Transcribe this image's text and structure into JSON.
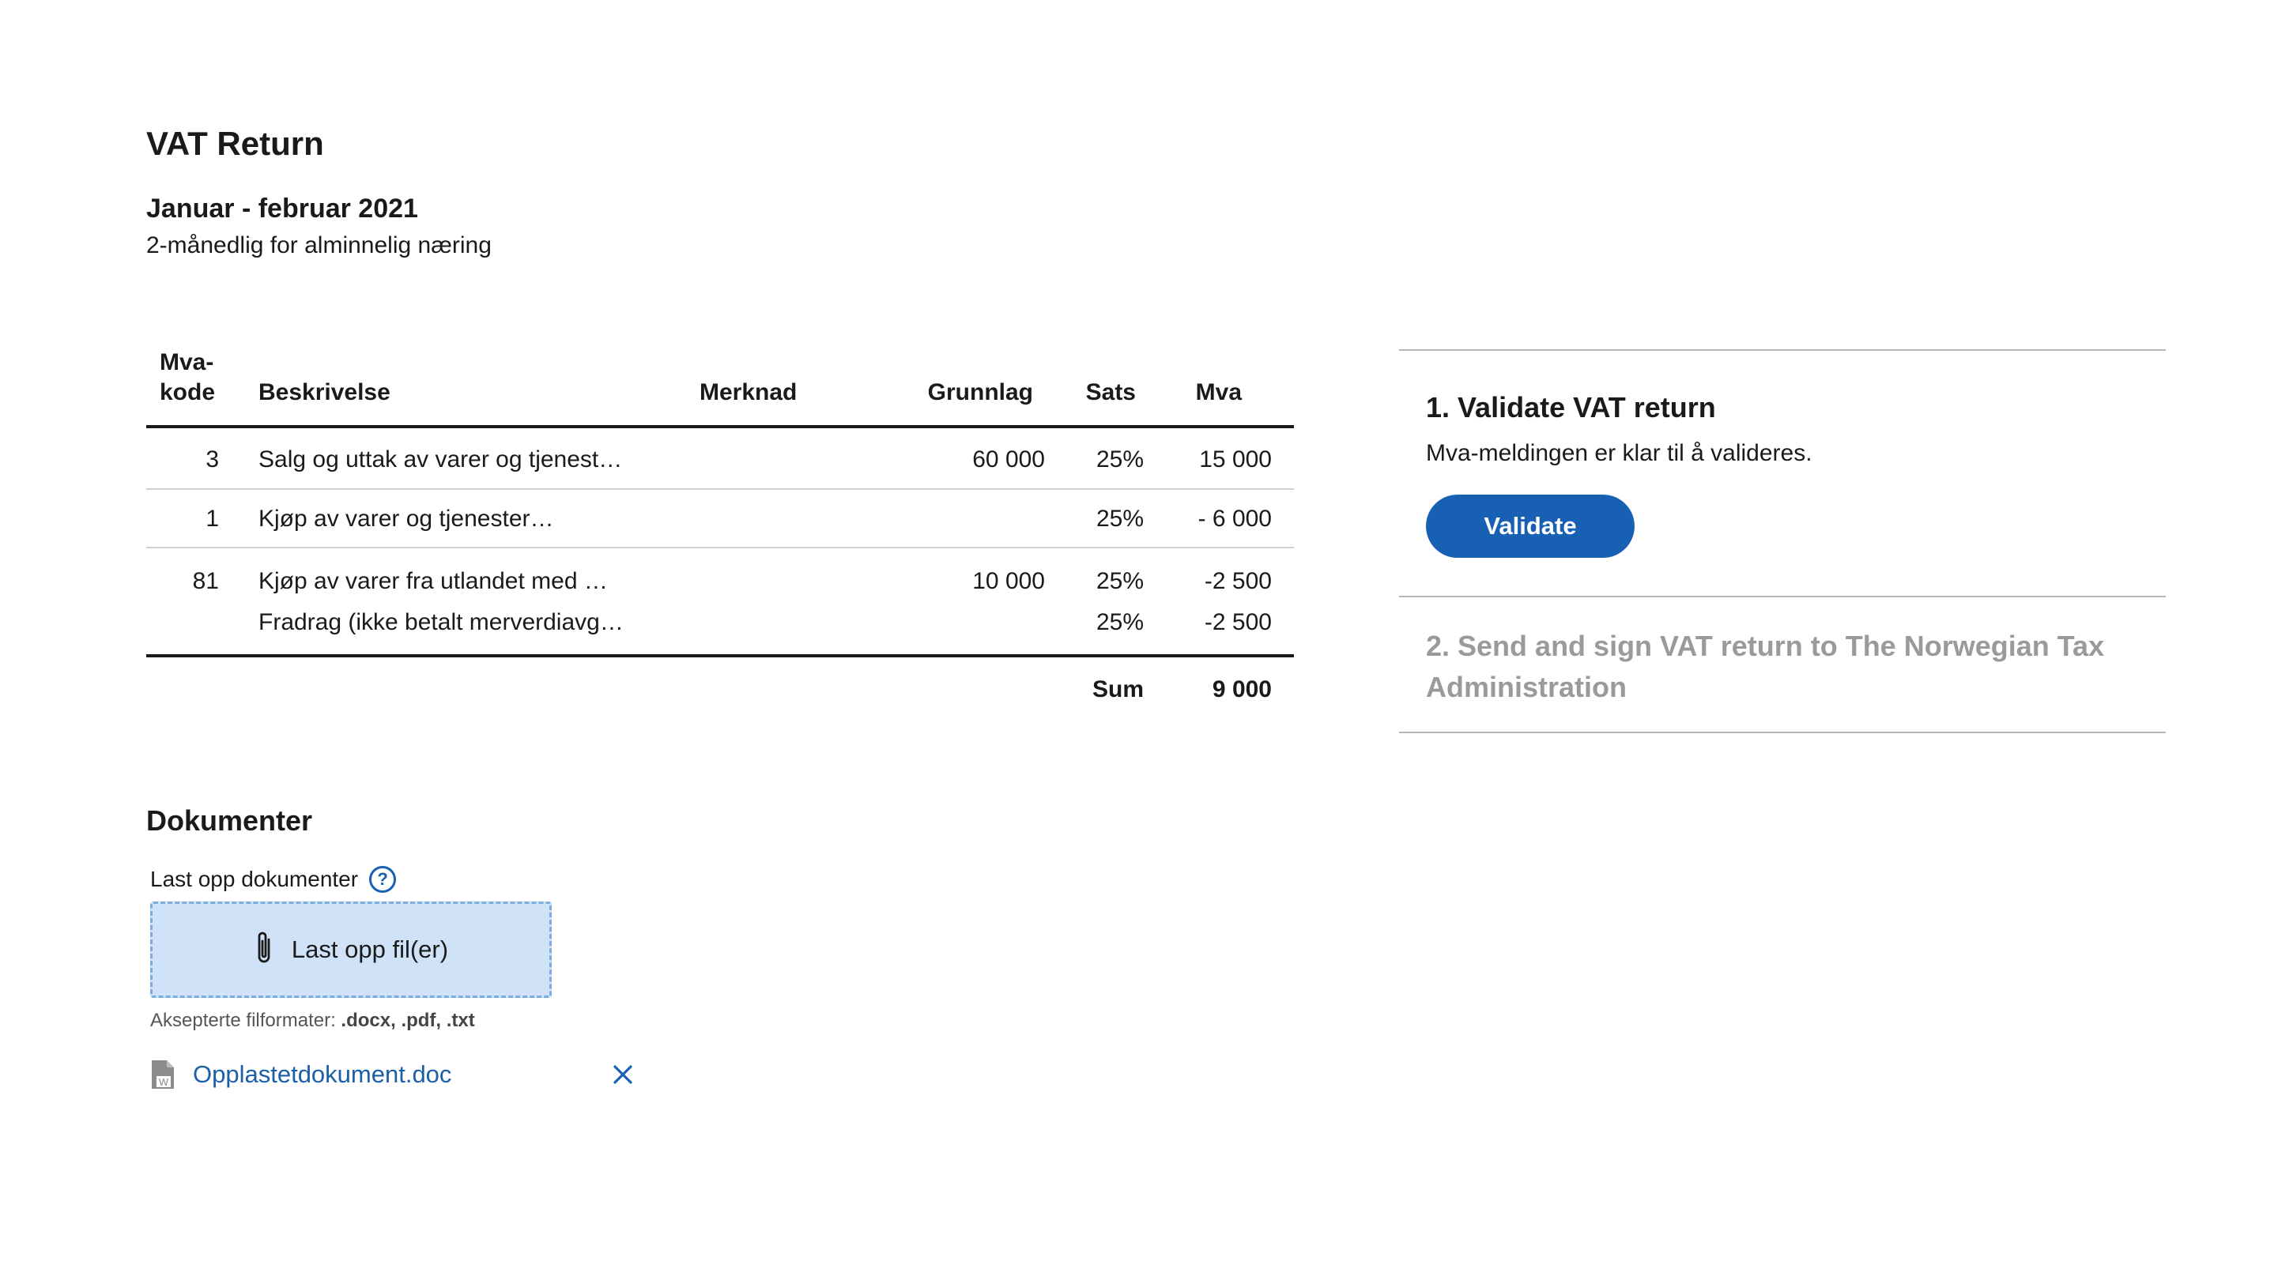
{
  "header": {
    "title": "VAT Return",
    "period": "Januar - februar 2021",
    "period_type": "2-månedlig for alminnelig næring"
  },
  "table": {
    "columns": {
      "kode_line1": "Mva-",
      "kode_line2": "kode",
      "beskrivelse": "Beskrivelse",
      "merknad": "Merknad",
      "grunnlag": "Grunnlag",
      "sats": "Sats",
      "mva": "Mva"
    },
    "rows": [
      {
        "kode": "3",
        "beskrivelse": "Salg og uttak av varer og tjenest…",
        "merknad": "",
        "grunnlag": "60 000",
        "sats": "25%",
        "mva": "15 000"
      },
      {
        "kode": "1",
        "beskrivelse": "Kjøp av varer og tjenester…",
        "merknad": "",
        "grunnlag": "",
        "sats": "25%",
        "mva": "- 6 000"
      },
      {
        "kode": "81",
        "beskrivelse": "Kjøp av varer fra utlandet med …",
        "merknad": "",
        "grunnlag": "10 000",
        "sats": "25%",
        "mva": "-2 500",
        "sub_beskrivelse": "Fradrag (ikke betalt merverdiavg…",
        "sub_sats": "25%",
        "sub_mva": "-2 500"
      }
    ],
    "sum_label": "Sum",
    "sum_value": "9 000"
  },
  "steps": [
    {
      "title": "1. Validate VAT return",
      "description": "Mva-meldingen er klar til å valideres.",
      "button_label": "Validate",
      "active": true
    },
    {
      "title": "2. Send and sign VAT return to The Norwegian Tax Administration",
      "active": false
    }
  ],
  "documents": {
    "title": "Dokumenter",
    "upload_label": "Last opp dokumenter",
    "help_glyph": "?",
    "upload_button": "Last opp fil(er)",
    "accepted_prefix": "Aksepterte filformater:",
    "accepted_formats": ".docx, .pdf, .txt",
    "files": [
      {
        "name": "Opplastetdokument.doc",
        "icon_letter": "W"
      }
    ]
  },
  "colors": {
    "primary": "#1760b3",
    "link": "#1a5fa8",
    "dropzone_bg": "#cfe2f8",
    "dropzone_border": "#7aaee3",
    "disabled_text": "#9a9a9a"
  },
  "icons": {
    "help": "question-circle-icon",
    "upload": "paperclip-icon",
    "file": "word-document-icon",
    "remove": "close-icon"
  }
}
